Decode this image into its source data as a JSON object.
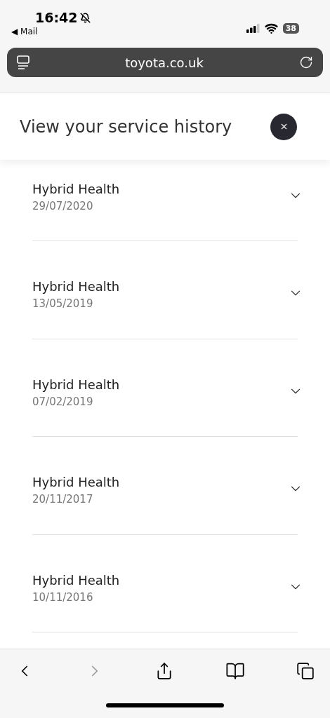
{
  "status_bar": {
    "time": "16:42",
    "back_app": "◀ Mail",
    "battery": "38",
    "muted": true
  },
  "address_bar": {
    "url": "toyota.co.uk"
  },
  "panel": {
    "title": "View your service history"
  },
  "services": [
    {
      "name": "Hybrid Health",
      "date": "29/07/2020",
      "expanded": false
    },
    {
      "name": "Hybrid Health",
      "date": "13/05/2019",
      "expanded": false
    },
    {
      "name": "Hybrid Health",
      "date": "07/02/2019",
      "expanded": false
    },
    {
      "name": "Hybrid Health",
      "date": "20/11/2017",
      "expanded": false
    },
    {
      "name": "Hybrid Health",
      "date": "10/11/2016",
      "expanded": false
    }
  ],
  "toolbar": {
    "back_disabled": false,
    "forward_disabled": true
  }
}
